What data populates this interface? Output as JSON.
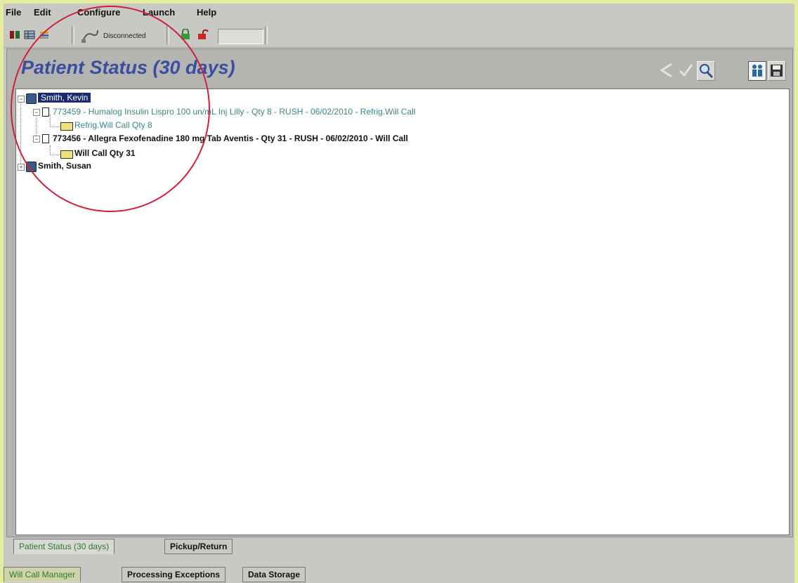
{
  "menu": [
    "File",
    "Edit",
    "Configure",
    "Launch",
    "Help"
  ],
  "toolbar": {
    "connection_status": "Disconnected",
    "icons": [
      "open-book-icon",
      "grid-icon",
      "stack-icon",
      "connection-plug-icon",
      "lock-closed-icon",
      "lock-open-icon"
    ]
  },
  "panel": {
    "title": "Patient Status (30 days)",
    "header_buttons": [
      "back-arrow-icon",
      "check-icon",
      "magnify-icon",
      "people-icon",
      "save-icon"
    ]
  },
  "tree": {
    "patients": [
      {
        "name": "Smith, Kevin",
        "selected": true,
        "prescriptions": [
          {
            "label": "773459 - Humalog Insulin Lispro 100 un/mL Inj Lilly - Qty 8 - RUSH - 06/02/2010 - Refrig.Will Call",
            "location": "Refrig.Will Call Qty 8",
            "style": "teal"
          },
          {
            "label": "773456 - Allegra Fexofenadine 180 mg Tab Aventis - Qty 31 - RUSH - 06/02/2010 - Will Call",
            "location": "Will Call Qty 31",
            "style": "dark"
          }
        ]
      },
      {
        "name": "Smith, Susan",
        "selected": false
      }
    ]
  },
  "inner_tabs": [
    "Patient Status (30 days)",
    "Pickup/Return"
  ],
  "outer_tabs": [
    "Will Call Manager",
    "Processing Exceptions",
    "Data Storage"
  ],
  "colors": {
    "title": "#3a4ea0",
    "selection": "#1d2a6e",
    "teal_text": "#3d8585",
    "active_tab_text": "#2f7a2f",
    "annotation_circle": "#cf1f3a",
    "outer_background": "#e6ec9e"
  }
}
